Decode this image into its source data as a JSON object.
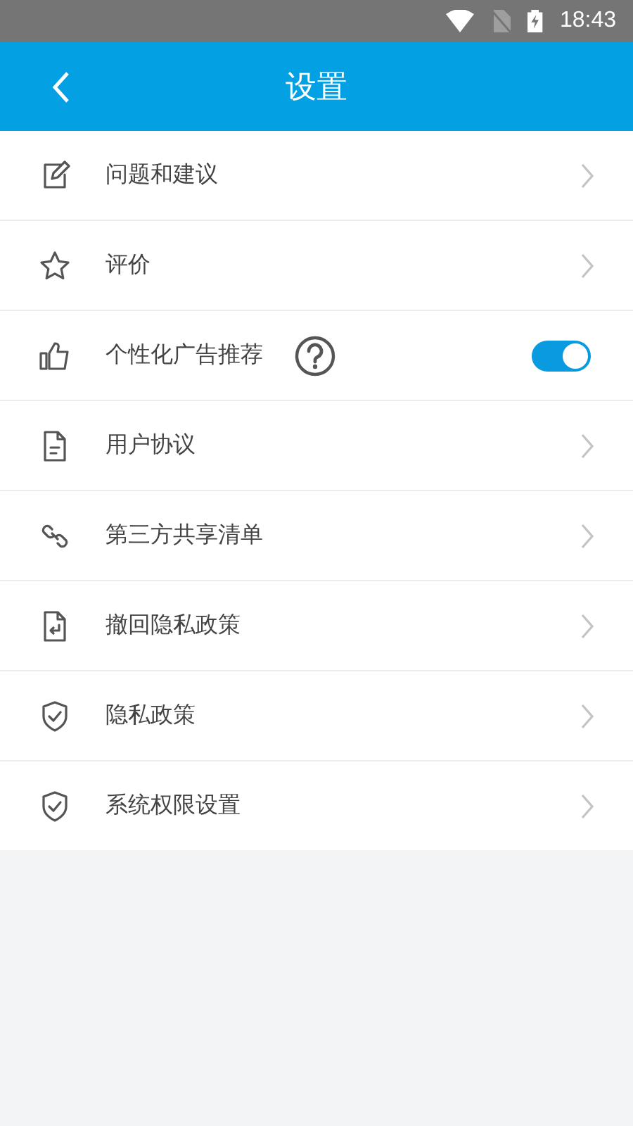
{
  "status_bar": {
    "time": "18:43"
  },
  "header": {
    "title": "设置"
  },
  "items": [
    {
      "kind": "link",
      "label": "问题和建议"
    },
    {
      "kind": "link",
      "label": "评价"
    },
    {
      "kind": "toggle",
      "label": "个性化广告推荐",
      "on": true
    },
    {
      "kind": "link",
      "label": "用户协议"
    },
    {
      "kind": "link",
      "label": "第三方共享清单"
    },
    {
      "kind": "link",
      "label": "撤回隐私政策"
    },
    {
      "kind": "link",
      "label": "隐私政策"
    },
    {
      "kind": "link",
      "label": "系统权限设置"
    }
  ]
}
